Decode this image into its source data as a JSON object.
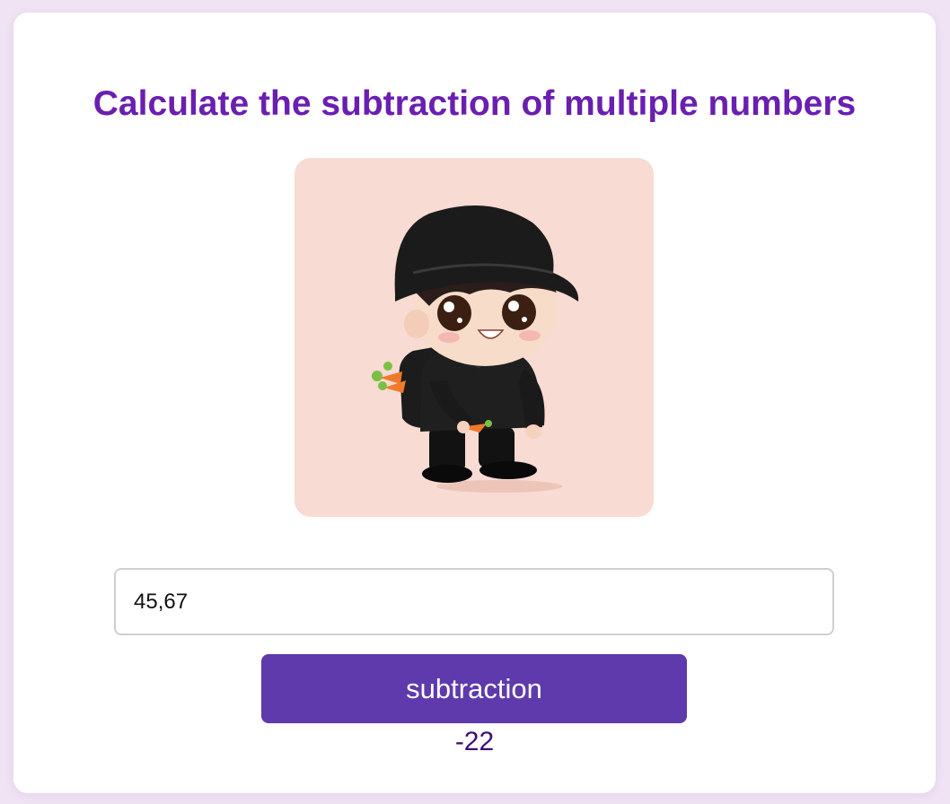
{
  "app": {
    "title": "Calculate the subtraction of multiple numbers"
  },
  "illustration": {
    "description_icon": "chibi-character-image",
    "background_color": "#f8dbd2"
  },
  "input": {
    "value": "45,67"
  },
  "button": {
    "label": "subtraction",
    "color": "#5e3aad"
  },
  "result": {
    "text": "-22"
  },
  "colors": {
    "page_background": "#f0e3f3",
    "title": "#6a1fb0",
    "result": "#3b0f7a"
  }
}
